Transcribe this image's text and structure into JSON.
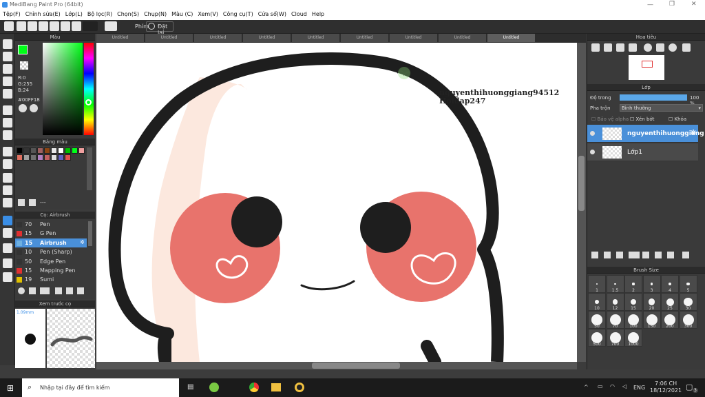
{
  "app": {
    "title": "MediBang Paint Pro (64bit)"
  },
  "menu": [
    "Tệp(F)",
    "Chỉnh sửa(E)",
    "Lớp(L)",
    "Bộ lọc(R)",
    "Chọn(S)",
    "Chụp(N)",
    "Màu (C)",
    "Xem(V)",
    "Công cụ(T)",
    "Cửa sổ(W)",
    "Cloud",
    "Help"
  ],
  "toolbar": {
    "shortcut_label": "Phím",
    "reset_label": "Đặt lại"
  },
  "color_panel": {
    "title": "Màu",
    "r": "R:0",
    "g": "G:255",
    "b": "B:24",
    "hex": "#00FF18",
    "fg_color": "#00ff18"
  },
  "palette_panel": {
    "title": "Bảng màu",
    "more": "---",
    "colors": [
      "#000000",
      "#333333",
      "#555555",
      "#a06060",
      "#8b4513",
      "#e8e8e8",
      "#ffffff",
      "#00c000",
      "#00ff18",
      "#f0a0a0",
      "#e07060",
      "#a0a0a0",
      "#707070",
      "#b080c0",
      "#c06060",
      "#e0e0e0",
      "#6060c0",
      "#e05050"
    ]
  },
  "brush_panel": {
    "title": "Cọ: Airbrush",
    "items": [
      {
        "size": "70",
        "name": "Pen",
        "color": "#333333"
      },
      {
        "size": "15",
        "name": "G Pen",
        "color": "#e03030"
      },
      {
        "size": "15",
        "name": "Airbrush",
        "color": "#6fb0e0",
        "selected": true
      },
      {
        "size": "10",
        "name": "Pen (Sharp)",
        "color": "#333333"
      },
      {
        "size": "50",
        "name": "Edge Pen",
        "color": "#333333"
      },
      {
        "size": "15",
        "name": "Mapping Pen",
        "color": "#e03030"
      },
      {
        "size": "19",
        "name": "Sumi",
        "color": "#e0c000"
      }
    ]
  },
  "preview_panel": {
    "title": "Xem trước cọ",
    "size": "1.09mm"
  },
  "tabs": [
    "Untitled",
    "Untitled",
    "Untitled",
    "Untitled",
    "Untitled",
    "Untitled",
    "Untitled",
    "Untitled",
    "Untitled"
  ],
  "canvas": {
    "watermark_line1": "nguyenthihuonggiang94512",
    "watermark_line2": "Hoidap247"
  },
  "navigator": {
    "title": "Hoa tiêu"
  },
  "layer_panel": {
    "title": "Lớp",
    "opacity_label": "Độ trong",
    "opacity_value": "100 %",
    "blend_label": "Pha trộn",
    "blend_value": "Bình thường",
    "protect_alpha": "Bảo vệ alpha",
    "clipping": "Xén bớt",
    "lock": "Khóa",
    "layers": [
      {
        "name": "nguyenthihuonggiang",
        "selected": true
      },
      {
        "name": "Lớp1",
        "selected": false
      }
    ]
  },
  "brush_size": {
    "title": "Brush Size",
    "sizes": [
      "1",
      "1.5",
      "2",
      "3",
      "4",
      "5",
      "10",
      "12",
      "15",
      "20",
      "25",
      "30",
      "50",
      "70",
      "100",
      "150",
      "200",
      "300",
      "500",
      "700",
      "1000"
    ]
  },
  "taskbar": {
    "search_placeholder": "Nhập tại đây để tìm kiếm",
    "lang": "ENG",
    "time": "7:06 CH",
    "date": "18/12/2021",
    "notif_count": "3"
  }
}
